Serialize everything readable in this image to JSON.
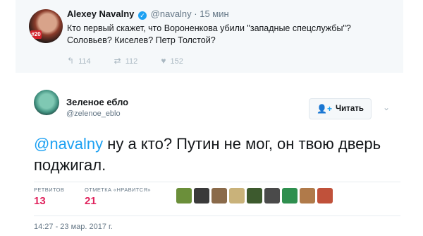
{
  "quoted": {
    "name": "Alexey Navalny",
    "handle": "@navalny",
    "time": "· 15 мин",
    "badge": "#20",
    "text": "Кто первый скажет, что Вороненкова убили \"западные спецслужбы\"? Соловьев? Киселев? Петр Толстой?",
    "reply_count": "114",
    "retweet_count": "112",
    "like_count": "152"
  },
  "tweet": {
    "user_name": "Зеленое ебло",
    "user_handle": "@zelenoe_eblo",
    "follow_label": "Читать",
    "mention": "@navalny",
    "text": " ну а кто? Путин не мог, он твою дверь поджигал.",
    "retweets_label": "РЕТВИТОВ",
    "retweets_value": "13",
    "likes_label": "ОТМЕТКА «НРАВИТСЯ»",
    "likes_value": "21",
    "timestamp": "14:27 - 23 мар. 2017 г."
  },
  "colors": {
    "accent": "#1da1f2",
    "like": "#e0245e",
    "muted": "#657786"
  },
  "icons": [
    "verified-icon",
    "reply-icon",
    "retweet-icon",
    "heart-icon",
    "follow-person-icon",
    "chevron-down-icon"
  ],
  "liker_avatars": [
    "#6b8f3a",
    "#3a3a3a",
    "#8a6a4a",
    "#c9b27a",
    "#3d5a2e",
    "#4a4a4a",
    "#2f8f4f",
    "#b07a4a",
    "#c0513a"
  ]
}
